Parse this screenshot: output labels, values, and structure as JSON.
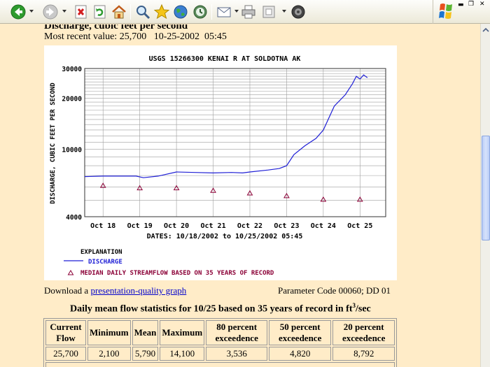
{
  "header": {
    "heading": "Discharge, cubic feet per second"
  },
  "recent": {
    "label": "Most recent value:",
    "value": "25,700",
    "date": "10-25-2002",
    "time": "05:45"
  },
  "graph": {
    "title": "USGS 15266300 KENAI R AT SOLDOTNA AK",
    "ylabel": "DISCHARGE, CUBIC FEET PER SECOND",
    "xlabel": "DATES: 10/18/2002 to 10/25/2002 05:45",
    "explanation_title": "EXPLANATION",
    "legend_discharge": "DISCHARGE",
    "legend_median": "MEDIAN DAILY STREAMFLOW BASED ON 35 YEARS OF RECORD",
    "colors": {
      "discharge": "#1f1fd6",
      "median": "#8b0037",
      "grid": "#9e9e9e"
    }
  },
  "chart_data": {
    "type": "line",
    "title": "USGS 15266300 KENAI R AT SOLDOTNA AK",
    "xlabel": "DATES: 10/18/2002 to 10/25/2002 05:45",
    "ylabel": "DISCHARGE, CUBIC FEET PER SECOND",
    "yscale": "log",
    "ylim": [
      4000,
      30000
    ],
    "xlim": [
      -0.5,
      7.7
    ],
    "yticks": [
      "4000",
      "10000",
      "20000",
      "30000"
    ],
    "xticks": [
      "Oct 18",
      "Oct 19",
      "Oct 20",
      "Oct 21",
      "Oct 22",
      "Oct 23",
      "Oct 24",
      "Oct 25"
    ],
    "grid": true,
    "series": [
      {
        "name": "DISCHARGE",
        "x": [
          -0.5,
          0,
          0.5,
          0.9,
          1.1,
          1.5,
          2,
          2.5,
          3,
          3.5,
          3.8,
          4,
          4.5,
          4.8,
          5,
          5.2,
          5.5,
          5.8,
          6,
          6.3,
          6.6,
          6.8,
          6.9,
          7.0,
          7.1,
          7.2
        ],
        "y": [
          6900,
          6950,
          6950,
          6950,
          6800,
          6950,
          7350,
          7300,
          7250,
          7300,
          7250,
          7350,
          7550,
          7700,
          8000,
          9300,
          10500,
          11600,
          13000,
          18000,
          21000,
          24500,
          27000,
          26000,
          27500,
          26500
        ]
      },
      {
        "name": "MEDIAN DAILY STREAMFLOW BASED ON 35 YEARS OF RECORD",
        "x": [
          0,
          1,
          2,
          3,
          4,
          5,
          6,
          7
        ],
        "y": [
          6100,
          5900,
          5900,
          5700,
          5500,
          5300,
          5050,
          5050
        ]
      }
    ]
  },
  "download": {
    "prefix": "Download a",
    "link": "presentation-quality graph"
  },
  "param": "Parameter Code 00060; DD 01",
  "stats": {
    "title": "Daily mean flow statistics for 10/25 based on 35 years of record in ft",
    "title_sup": "3",
    "title_suffix": "/sec",
    "headers": [
      "Current Flow",
      "Minimum",
      "Mean",
      "Maximum",
      "80 percent exceedence",
      "50 percent exceedence",
      "20 percent exceedence"
    ],
    "values": [
      "25,700",
      "2,100",
      "5,790",
      "14,100",
      "3,536",
      "4,820",
      "8,792"
    ]
  }
}
